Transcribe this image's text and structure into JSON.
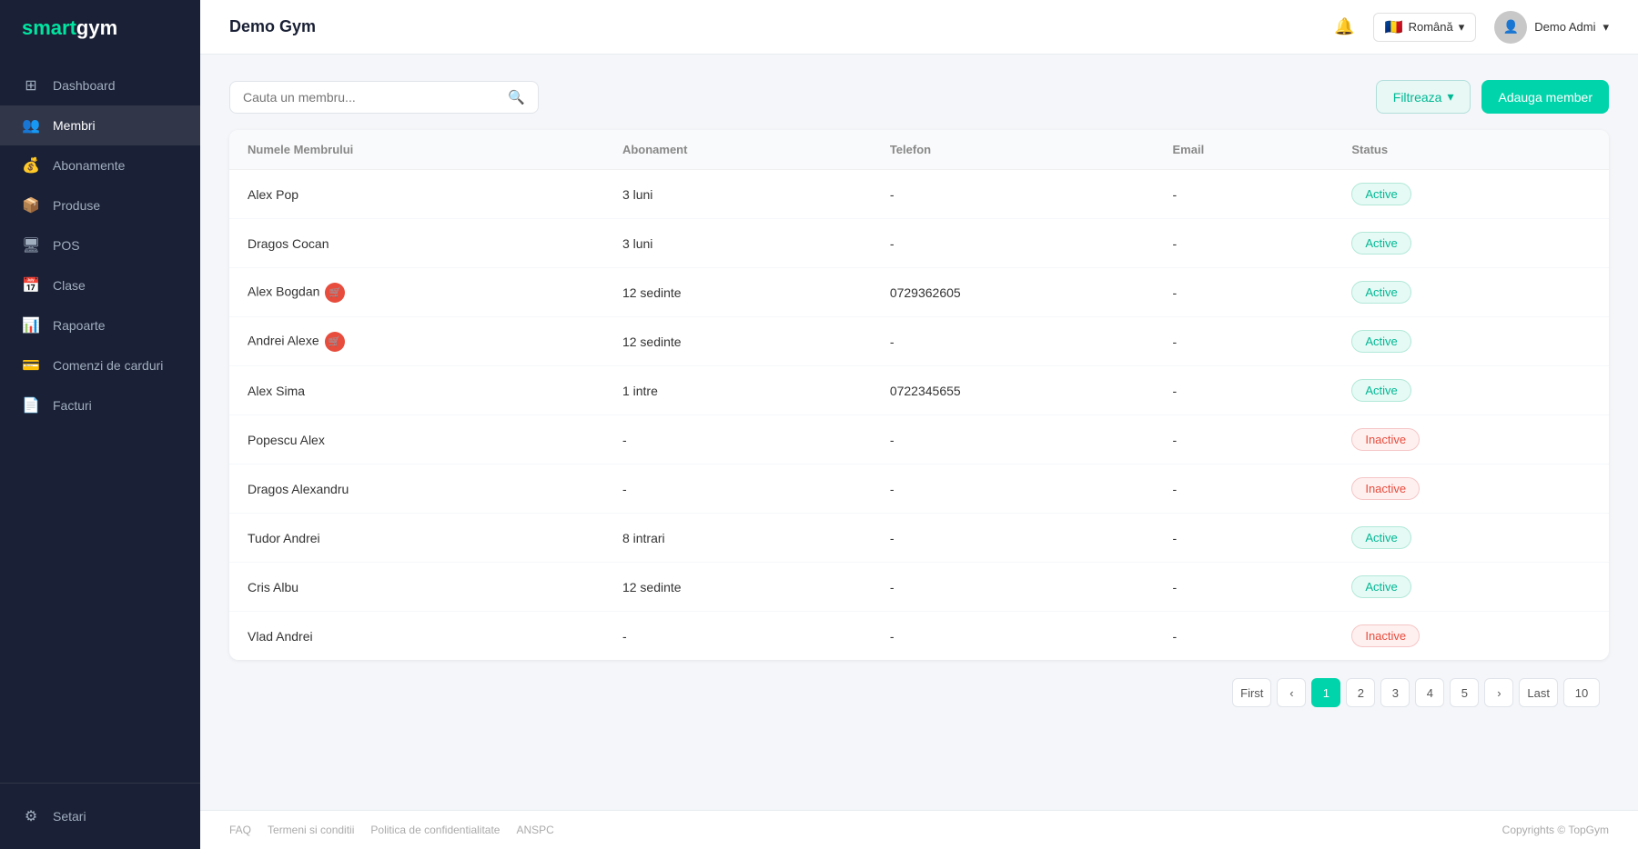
{
  "brand": {
    "smart": "smart",
    "gym": "gym"
  },
  "sidebar": {
    "items": [
      {
        "id": "dashboard",
        "label": "Dashboard",
        "icon": "⊞"
      },
      {
        "id": "membri",
        "label": "Membri",
        "icon": "👤"
      },
      {
        "id": "abonamente",
        "label": "Abonamente",
        "icon": "📋"
      },
      {
        "id": "produse",
        "label": "Produse",
        "icon": "📊"
      },
      {
        "id": "pos",
        "label": "POS",
        "icon": "🖥"
      },
      {
        "id": "clase",
        "label": "Clase",
        "icon": "📈"
      },
      {
        "id": "rapoarte",
        "label": "Rapoarte",
        "icon": "📉"
      },
      {
        "id": "comenzi",
        "label": "Comenzi de carduri",
        "icon": "💳"
      },
      {
        "id": "facturi",
        "label": "Facturi",
        "icon": "🗒"
      }
    ],
    "bottom": [
      {
        "id": "setari",
        "label": "Setari",
        "icon": "⚙"
      }
    ]
  },
  "header": {
    "title": "Demo Gym",
    "lang_label": "Română",
    "user_label": "Demo Admi",
    "user_arrow": "▾"
  },
  "toolbar": {
    "search_placeholder": "Cauta un membru...",
    "filter_label": "Filtreaza",
    "filter_arrow": "▾",
    "add_label": "Adauga member"
  },
  "table": {
    "columns": [
      "Numele Membrului",
      "Abonament",
      "Telefon",
      "Email",
      "Status"
    ],
    "rows": [
      {
        "name": "Alex Pop",
        "hasCart": false,
        "abonament": "3 luni",
        "telefon": "-",
        "email": "-",
        "status": "Active"
      },
      {
        "name": "Dragos Cocan",
        "hasCart": false,
        "abonament": "3 luni",
        "telefon": "-",
        "email": "-",
        "status": "Active"
      },
      {
        "name": "Alex Bogdan",
        "hasCart": true,
        "abonament": "12 sedinte",
        "telefon": "0729362605",
        "email": "-",
        "status": "Active"
      },
      {
        "name": "Andrei Alexe",
        "hasCart": true,
        "abonament": "12 sedinte",
        "telefon": "-",
        "email": "-",
        "status": "Active"
      },
      {
        "name": "Alex Sima",
        "hasCart": false,
        "abonament": "1 intre",
        "telefon": "0722345655",
        "email": "-",
        "status": "Active"
      },
      {
        "name": "Popescu Alex",
        "hasCart": false,
        "abonament": "-",
        "telefon": "-",
        "email": "-",
        "status": "Inactive"
      },
      {
        "name": "Dragos Alexandru",
        "hasCart": false,
        "abonament": "-",
        "telefon": "-",
        "email": "-",
        "status": "Inactive"
      },
      {
        "name": "Tudor Andrei",
        "hasCart": false,
        "abonament": "8 intrari",
        "telefon": "-",
        "email": "-",
        "status": "Active"
      },
      {
        "name": "Cris Albu",
        "hasCart": false,
        "abonament": "12 sedinte",
        "telefon": "-",
        "email": "-",
        "status": "Active"
      },
      {
        "name": "Vlad Andrei",
        "hasCart": false,
        "abonament": "-",
        "telefon": "-",
        "email": "-",
        "status": "Inactive"
      }
    ]
  },
  "pagination": {
    "first": "First",
    "prev": "‹",
    "next": "›",
    "last": "Last",
    "pages": [
      "1",
      "2",
      "3",
      "4",
      "5"
    ],
    "active_page": "1",
    "per_page": "10"
  },
  "footer": {
    "links": [
      "FAQ",
      "Termeni si conditii",
      "Politica de confidentialitate",
      "ANSPC"
    ],
    "copyright": "Copyrights © TopGym"
  }
}
